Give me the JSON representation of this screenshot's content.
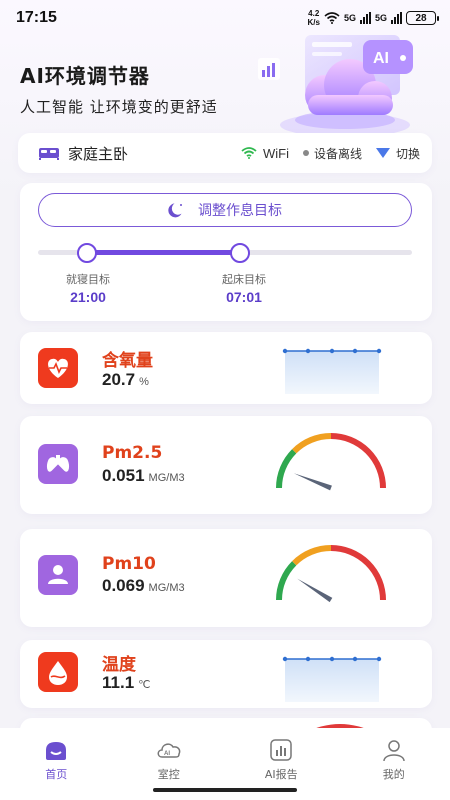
{
  "status_bar": {
    "time": "17:15",
    "net_speed_top": "4.2",
    "net_speed_bottom": "K/s",
    "sig1": "5G",
    "sig2": "5G",
    "battery": "28"
  },
  "header": {
    "title": "AI环境调节器",
    "subtitle": "人工智能 让环境变的更舒适",
    "hero_badge": "AI"
  },
  "home": {
    "name": "家庭主卧",
    "wifi_label": "WiFi",
    "status": "设备离线",
    "switch_label": "切换"
  },
  "sleep": {
    "adjust_label": "调整作息目标",
    "bedtime_label": "就寝目标",
    "bedtime": "21:00",
    "wake_label": "起床目标",
    "wake": "07:01",
    "range_start_fraction": 0.13,
    "range_end_fraction": 0.54
  },
  "metrics": [
    {
      "name": "含氧量",
      "value": "20.7",
      "unit": "%",
      "color": "#ef3a1e",
      "icon": "heart-icon",
      "widget": "sparkline"
    },
    {
      "name": "Pm2.5",
      "value": "0.051",
      "unit": "MG/M3",
      "color": "#a066e0",
      "icon": "lungs-icon",
      "widget": "gauge",
      "gauge_fraction": 0.12
    },
    {
      "name": "Pm10",
      "value": "0.069",
      "unit": "MG/M3",
      "color": "#a066e0",
      "icon": "person-icon",
      "widget": "gauge",
      "gauge_fraction": 0.18
    },
    {
      "name": "温度",
      "value": "11.1",
      "unit": "℃",
      "color": "#ef3a1e",
      "icon": "drop-icon",
      "widget": "sparkline"
    }
  ],
  "nav": [
    {
      "label": "首页",
      "icon": "home-icon",
      "active": true
    },
    {
      "label": "室控",
      "icon": "cloud-ai-icon",
      "active": false
    },
    {
      "label": "AI报告",
      "icon": "report-chart-icon",
      "active": false
    },
    {
      "label": "我的",
      "icon": "user-icon",
      "active": false
    }
  ],
  "colors": {
    "accent": "#6b4fcf",
    "metric_name": "#e0421c",
    "spark": "#2f6fd1",
    "gauge_green": "#2fa84f",
    "gauge_orange": "#f0a020",
    "gauge_red": "#e03a3a"
  }
}
